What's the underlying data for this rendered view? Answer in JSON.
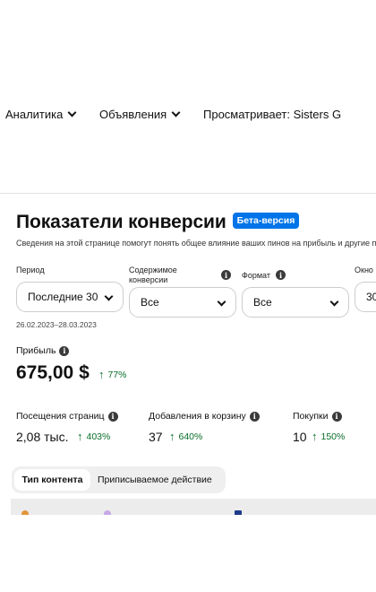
{
  "nav": {
    "analytics": "Аналитика",
    "ads": "Объявления",
    "viewing": "Просматривает: Sisters G"
  },
  "header": {
    "title": "Показатели конверсии",
    "badge": "Бета-версия",
    "subtitle": "Сведения на этой странице помогут понять общее влияние ваших пинов на прибыль и другие по"
  },
  "filters": {
    "period_label": "Период",
    "period_value": "Последние 30",
    "content_label": "Содержимое конверсии",
    "content_value": "Все",
    "format_label": "Формат",
    "format_value": "Все",
    "window_label": "Окно",
    "window_value": "30",
    "date_range": "26.02.2023–28.03.2023"
  },
  "metrics": {
    "profit": {
      "label": "Прибыль",
      "value": "675,00 $",
      "delta": "77%"
    },
    "page_visits": {
      "label": "Посещения страниц",
      "value": "2,08 тыс.",
      "delta": "403%"
    },
    "add_to_cart": {
      "label": "Добавления в корзину",
      "value": "37",
      "delta": "640%"
    },
    "purchases": {
      "label": "Покупки",
      "value": "10",
      "delta": "150%"
    }
  },
  "tabs": {
    "content_type": "Тип контента",
    "attributed_action": "Приписываемое действие"
  },
  "colors": {
    "accent": "#0074e8",
    "positive": "#0a6e2b",
    "legend_1": "#e3953b",
    "legend_2": "#c7a7e6",
    "legend_3": "#1d3b8c"
  }
}
